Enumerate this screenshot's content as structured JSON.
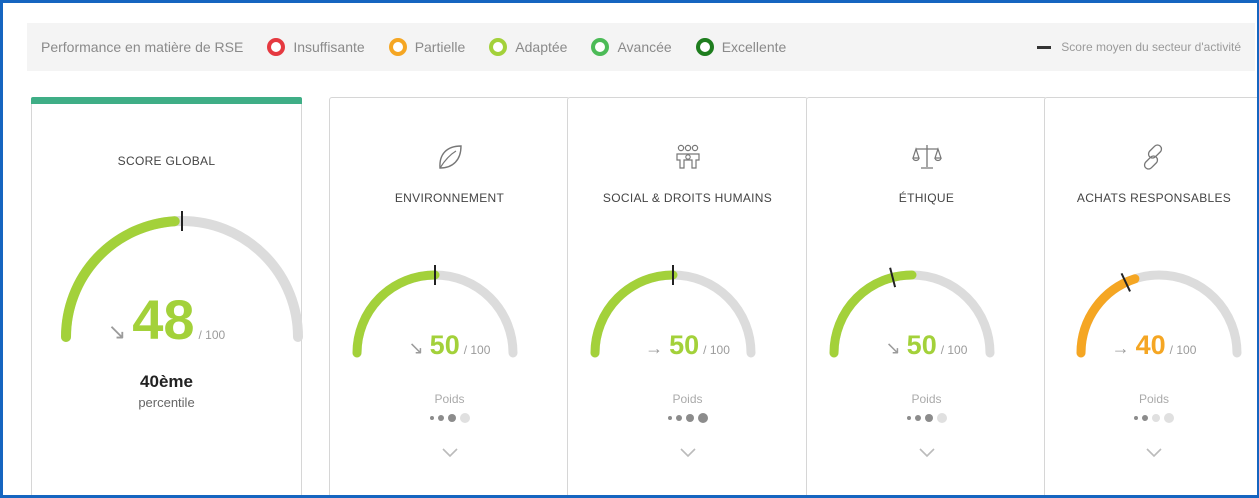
{
  "legend": {
    "title": "Performance en matière de RSE",
    "items": [
      {
        "label": "Insuffisante",
        "color": "#e53940"
      },
      {
        "label": "Partielle",
        "color": "#f5a623"
      },
      {
        "label": "Adaptée",
        "color": "#a3d13a"
      },
      {
        "label": "Avancée",
        "color": "#4cbb57"
      },
      {
        "label": "Excellente",
        "color": "#1e7d1e"
      }
    ],
    "average_label": "Score moyen du secteur d'activité"
  },
  "global": {
    "title": "SCORE GLOBAL",
    "score": 48,
    "score_fraction": 0.48,
    "sector_average_fraction": 0.5,
    "max_label": "/ 100",
    "trend": "↘",
    "color": "#a3d13a",
    "percentile_rank": "40ème",
    "percentile_label": "percentile"
  },
  "categories": [
    {
      "title": "ENVIRONNEMENT",
      "icon": "leaf-icon",
      "score": 50,
      "score_fraction": 0.5,
      "sector_average_fraction": 0.5,
      "max_label": "/ 100",
      "trend": "↘",
      "color": "#a3d13a",
      "weight_label": "Poids",
      "weight_level": 3
    },
    {
      "title": "SOCIAL & DROITS HUMAINS",
      "icon": "people-icon",
      "score": 50,
      "score_fraction": 0.5,
      "sector_average_fraction": 0.5,
      "max_label": "/ 100",
      "trend": "→",
      "color": "#a3d13a",
      "weight_label": "Poids",
      "weight_level": 4
    },
    {
      "title": "ÉTHIQUE",
      "icon": "scales-icon",
      "score": 50,
      "score_fraction": 0.5,
      "sector_average_fraction": 0.42,
      "max_label": "/ 100",
      "trend": "↘",
      "color": "#a3d13a",
      "weight_label": "Poids",
      "weight_level": 3
    },
    {
      "title": "ACHATS RESPONSABLES",
      "icon": "link-icon",
      "score": 40,
      "score_fraction": 0.4,
      "sector_average_fraction": 0.36,
      "max_label": "/ 100",
      "trend": "→",
      "color": "#f5a623",
      "weight_label": "Poids",
      "weight_level": 2
    }
  ]
}
